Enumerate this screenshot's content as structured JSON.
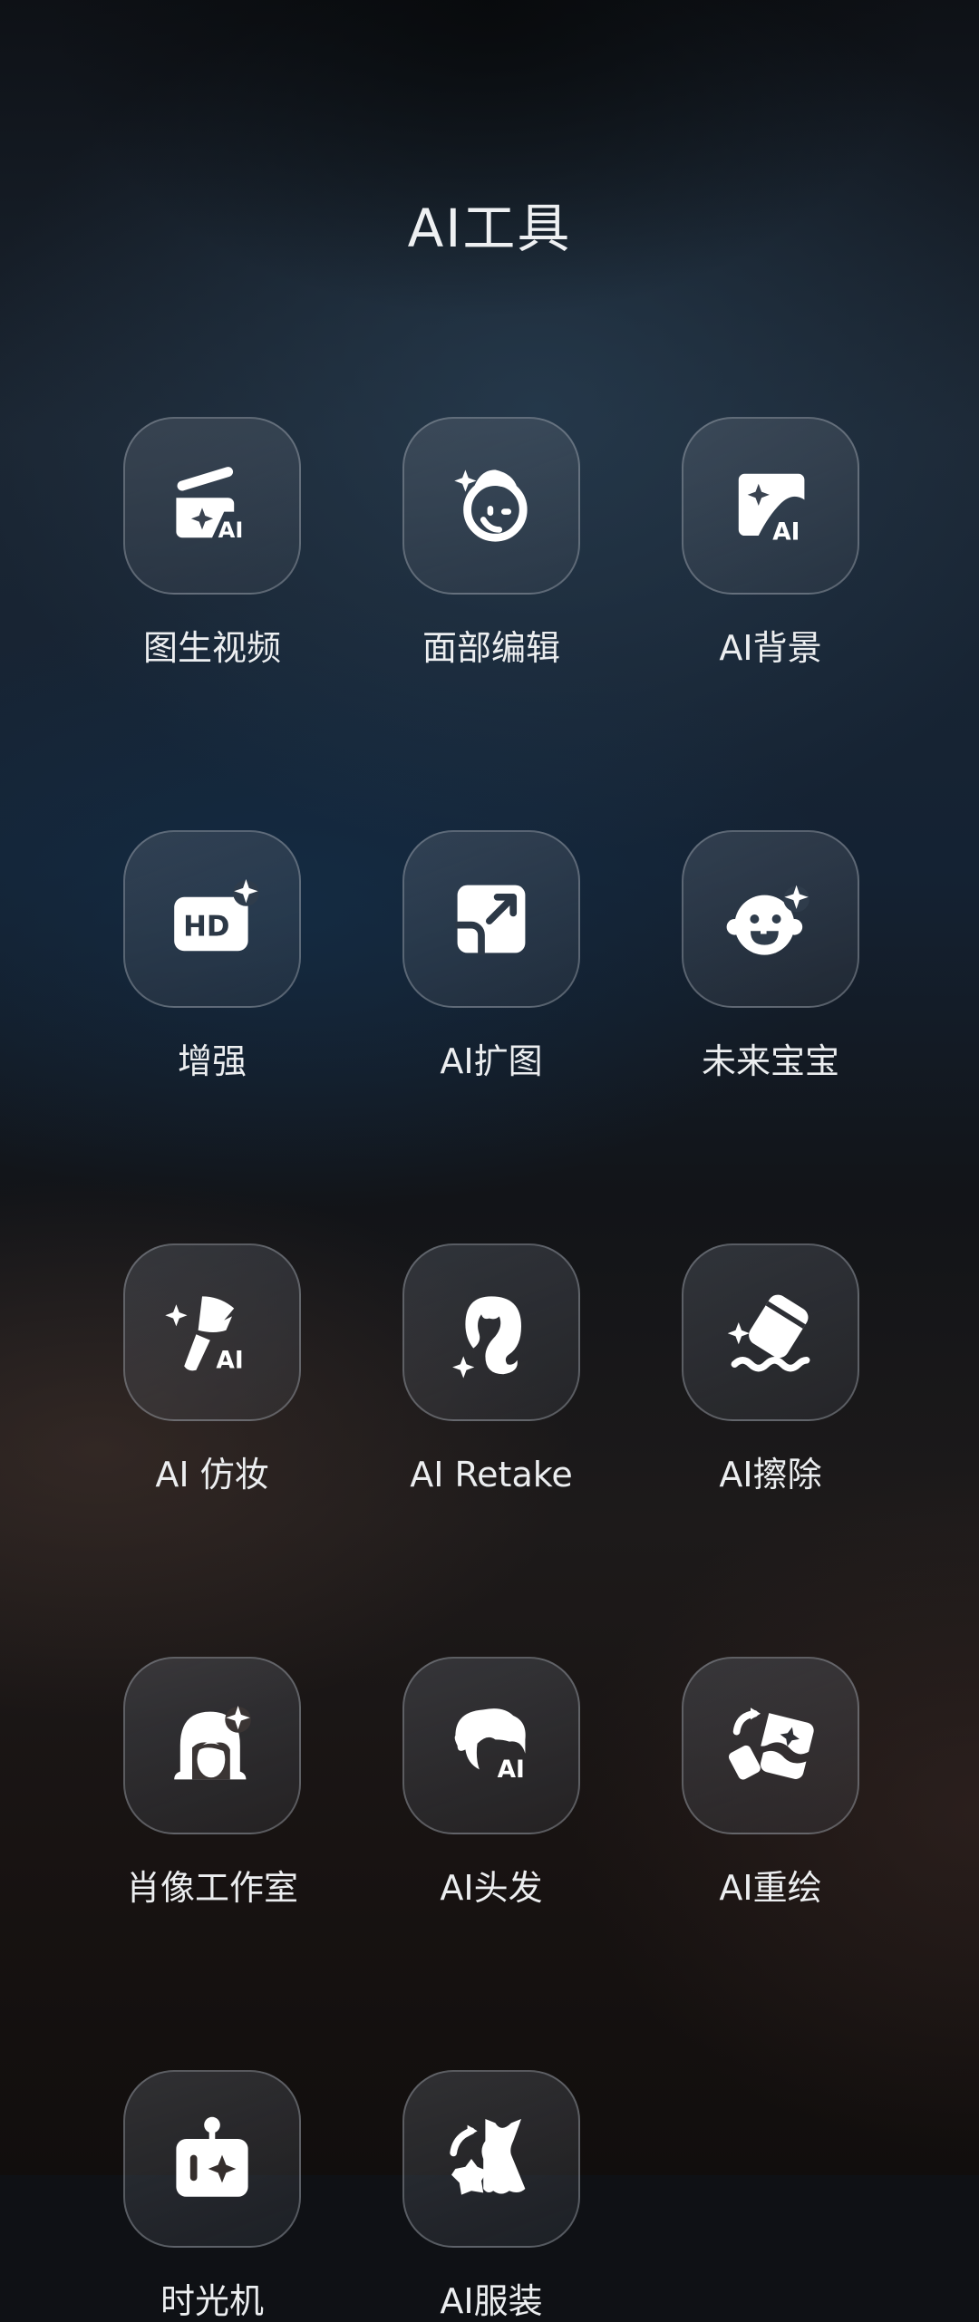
{
  "page": {
    "title": "AI工具"
  },
  "tools": [
    {
      "label": "图生视频",
      "icon": "image-to-video-icon"
    },
    {
      "label": "面部编辑",
      "icon": "face-edit-icon"
    },
    {
      "label": "AI背景",
      "icon": "ai-background-icon"
    },
    {
      "label": "增强",
      "icon": "hd-enhance-icon"
    },
    {
      "label": "AI扩图",
      "icon": "expand-image-icon"
    },
    {
      "label": "未来宝宝",
      "icon": "baby-face-icon"
    },
    {
      "label": "AI 仿妆",
      "icon": "makeup-brush-icon"
    },
    {
      "label": "AI Retake",
      "icon": "hair-retake-icon"
    },
    {
      "label": "AI擦除",
      "icon": "eraser-icon"
    },
    {
      "label": "肖像工作室",
      "icon": "portrait-studio-icon"
    },
    {
      "label": "AI头发",
      "icon": "ai-hair-icon"
    },
    {
      "label": "AI重绘",
      "icon": "redraw-icon"
    },
    {
      "label": "时光机",
      "icon": "time-machine-robot-icon"
    },
    {
      "label": "AI服装",
      "icon": "ai-clothing-dress-icon"
    }
  ]
}
